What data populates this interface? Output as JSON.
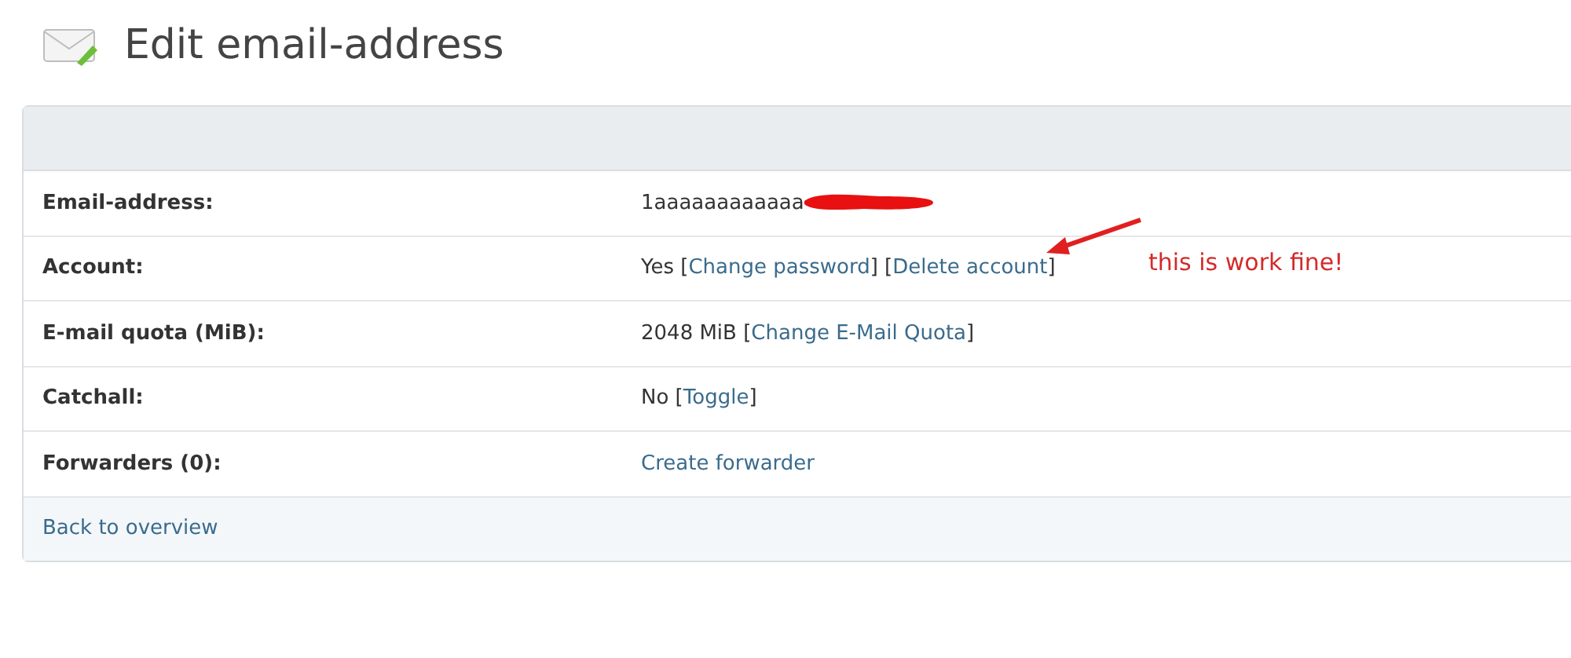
{
  "page_title": "Edit email-address",
  "rows": [
    {
      "label": "Email-address:",
      "parts": [
        {
          "kind": "text",
          "text": "1aaaaaaaaaaaa"
        },
        {
          "kind": "redaction"
        }
      ]
    },
    {
      "label": "Account:",
      "parts": [
        {
          "kind": "text",
          "text": "Yes ["
        },
        {
          "kind": "link",
          "text": "Change password"
        },
        {
          "kind": "text",
          "text": "] ["
        },
        {
          "kind": "link",
          "text": "Delete account"
        },
        {
          "kind": "text",
          "text": "]"
        }
      ]
    },
    {
      "label": "E-mail quota (MiB):",
      "parts": [
        {
          "kind": "text",
          "text": "2048 MiB ["
        },
        {
          "kind": "link",
          "text": "Change E-Mail Quota"
        },
        {
          "kind": "text",
          "text": "]"
        }
      ]
    },
    {
      "label": "Catchall:",
      "parts": [
        {
          "kind": "text",
          "text": "No ["
        },
        {
          "kind": "link",
          "text": "Toggle"
        },
        {
          "kind": "text",
          "text": "]"
        }
      ]
    },
    {
      "label": "Forwarders (0):",
      "parts": [
        {
          "kind": "link",
          "text": "Create forwarder"
        }
      ]
    }
  ],
  "footer_link": "Back to overview",
  "annotation": {
    "text": "this is work fine!"
  }
}
